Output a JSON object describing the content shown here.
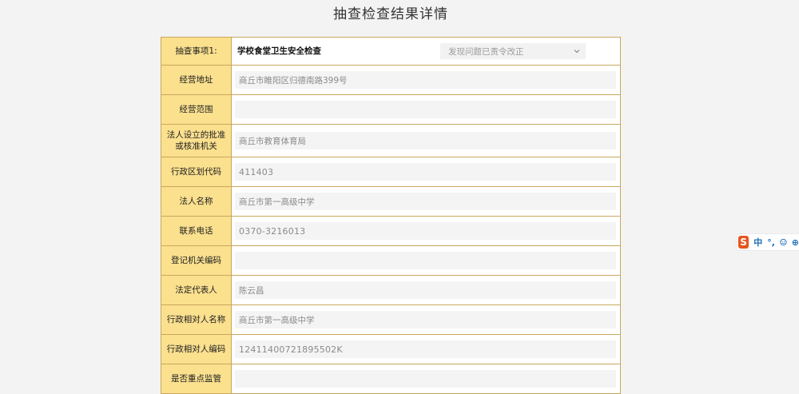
{
  "page_title": "抽查检查结果详情",
  "inspection": {
    "label": "抽查事项1:",
    "name": "学校食堂卫生安全检查",
    "result_select": "发现问题已责令改正"
  },
  "fields": [
    {
      "label": "经营地址",
      "value": "商丘市睢阳区归德南路399号"
    },
    {
      "label": "经营范围",
      "value": ""
    },
    {
      "label": "法人设立的批准或核准机关",
      "value": "商丘市教育体育局"
    },
    {
      "label": "行政区划代码",
      "value": "411403"
    },
    {
      "label": "法人名称",
      "value": "商丘市第一高级中学"
    },
    {
      "label": "联系电话",
      "value": "0370-3216013"
    },
    {
      "label": "登记机关编码",
      "value": ""
    },
    {
      "label": "法定代表人",
      "value": "陈云昌"
    },
    {
      "label": "行政相对人名称",
      "value": "商丘市第一高级中学"
    },
    {
      "label": "行政相对人编码",
      "value": "12411400721895502K"
    },
    {
      "label": "是否重点监管",
      "value": ""
    }
  ],
  "ime_toolbar": {
    "logo": "S",
    "mode": "中",
    "punct": "°,",
    "emoji_icon": "smile-icon",
    "extra": "⊕"
  }
}
